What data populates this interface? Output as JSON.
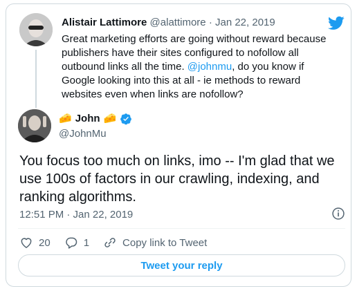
{
  "parent_tweet": {
    "author_name": "Alistair Lattimore",
    "handle": "@alattimore",
    "separator": "·",
    "date": "Jan 22, 2019",
    "text_before_mention": "Great marketing efforts are going without reward because publishers have their sites configured to nofollow all outbound links all the time. ",
    "mention": "@johnmu",
    "text_after_mention": ", do you know if Google looking into this at all - ie methods to reward websites even when links are nofollow?"
  },
  "tweet": {
    "author_name": "John",
    "name_emoji": "🧀",
    "handle": "@JohnMu",
    "text": "You focus too much on links, imo -- I'm glad that we use 100s of factors in our crawling, indexing, and ranking algorithms.",
    "timestamp": "12:51 PM · Jan 22, 2019"
  },
  "actions": {
    "likes": "20",
    "replies": "1",
    "copy_link_label": "Copy link to Tweet"
  },
  "reply_button_label": "Tweet your reply",
  "colors": {
    "accent": "#1d9bf0",
    "text": "#0f1419",
    "muted": "#536471",
    "border": "#cfd9de",
    "verified": "#1d9bf0"
  },
  "icons": [
    "twitter-bird-icon",
    "verified-badge-icon",
    "info-icon",
    "heart-icon",
    "reply-icon",
    "link-icon"
  ]
}
